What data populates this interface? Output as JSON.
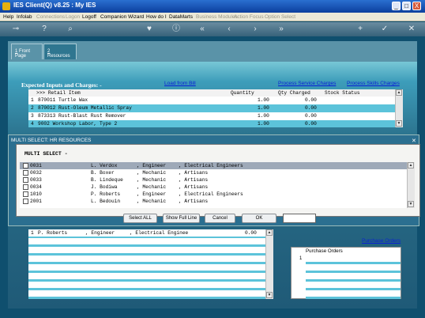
{
  "window": {
    "title": "IES Client(Q) v8.25 : My IES",
    "controls": [
      "_",
      "□",
      "X"
    ]
  },
  "menu": [
    {
      "label": "Help",
      "disabled": false
    },
    {
      "label": "Infolab",
      "disabled": false
    },
    {
      "label": "Connections",
      "disabled": true
    },
    {
      "label": "Logon",
      "disabled": true
    },
    {
      "label": "Logoff",
      "disabled": false
    },
    {
      "label": "Companion",
      "disabled": false
    },
    {
      "label": "Wizard",
      "disabled": false
    },
    {
      "label": "How do I",
      "disabled": false
    },
    {
      "label": "DataMarts",
      "disabled": false
    },
    {
      "label": "Business Modules",
      "disabled": true
    },
    {
      "label": "Action Focus",
      "disabled": true
    },
    {
      "label": "Option Select",
      "disabled": true
    }
  ],
  "toolbar_icons": [
    "key-icon",
    "help-icon",
    "search-icon",
    "heart-icon",
    "info-icon",
    "first-icon",
    "prev-icon",
    "next-icon",
    "last-icon",
    "add-icon",
    "accept-icon",
    "cancel-icon"
  ],
  "tabs": [
    {
      "num": "1",
      "label": " Front Page"
    },
    {
      "num": "2",
      "label": " Resources"
    }
  ],
  "upper": {
    "title": "Expected Inputs and Charges: -",
    "load_link": "Load from Bill",
    "service_link": "Process Service Charges",
    "skills_link": "Process Skills Charges",
    "columns": [
      ">>> Retail Item",
      "Quantity",
      "Qty Charged",
      "Stock Status"
    ],
    "rows": [
      {
        "n": "1",
        "item": "870011 Turtle Wax",
        "qty": "1.00",
        "charged": "0.00"
      },
      {
        "n": "2",
        "item": "870012 Rust-Oleum Metallic Spray",
        "qty": "1.00",
        "charged": "0.00"
      },
      {
        "n": "3",
        "item": "873313 Rust-Blast Rust Remover",
        "qty": "1.00",
        "charged": "0.00"
      },
      {
        "n": "4",
        "item": "9002 Workshop Labor, Type 2",
        "qty": "1.00",
        "charged": "0.00"
      }
    ]
  },
  "dialog": {
    "title": "MULTI SELECT: HR RESOURCES",
    "heading": "MULTI SELECT -",
    "rows": [
      {
        "code": "0031",
        "name": "L. Verdox",
        "role": ", Engineer",
        "group": ", Electrical Engineers"
      },
      {
        "code": "0032",
        "name": "B. Boxer",
        "role": ", Mechanic",
        "group": ", Artisans"
      },
      {
        "code": "0033",
        "name": "B. Lindeque",
        "role": ", Mechanic",
        "group": ", Artisans"
      },
      {
        "code": "0034",
        "name": "J. Bodiwa",
        "role": ", Mechanic",
        "group": ", Artisans"
      },
      {
        "code": "1010",
        "name": "P. Roberts",
        "role": ", Engineer",
        "group": ", Electrical Engineers"
      },
      {
        "code": "2001",
        "name": "L. Bedouin",
        "role": ", Mechanic",
        "group": ", Artisans"
      }
    ],
    "buttons": {
      "select_all": "Select ALL",
      "show_full": "Show Full Line",
      "cancel": "Cancel",
      "ok": "OK"
    },
    "input_value": ""
  },
  "lower": {
    "row": {
      "n": "1",
      "name": "P. Roberts",
      "role": ", Engineer",
      "group": ", Electrical Enginee",
      "value": "0.00"
    },
    "purchase_link": "Purchase Orders",
    "po_header": "Purchase Orders",
    "po_row": "1"
  }
}
